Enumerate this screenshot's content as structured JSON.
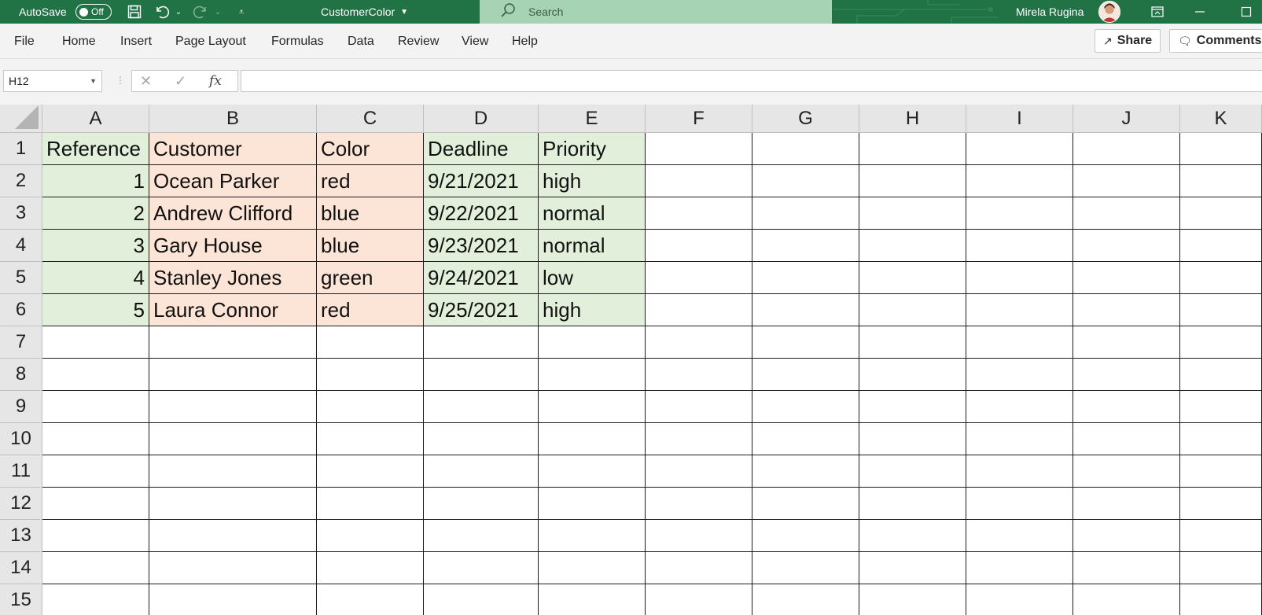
{
  "titlebar": {
    "autosave_label": "AutoSave",
    "autosave_state": "Off",
    "document_title": "CustomerColor",
    "search_placeholder": "Search",
    "user_name": "Mirela Rugina",
    "accent_color": "#217346"
  },
  "menu": {
    "items": [
      "File",
      "Home",
      "Insert",
      "Page Layout",
      "Formulas",
      "Data",
      "Review",
      "View",
      "Help"
    ],
    "share_label": "Share",
    "comments_label": "Comments"
  },
  "formula_bar": {
    "name_box": "H12",
    "cancel_glyph": "✕",
    "enter_glyph": "✓",
    "fx_label": "fx",
    "formula_value": ""
  },
  "sheet": {
    "columns": [
      "A",
      "B",
      "C",
      "D",
      "E",
      "F",
      "G",
      "H",
      "I",
      "J",
      "K"
    ],
    "rows": [
      "1",
      "2",
      "3",
      "4",
      "5",
      "6",
      "7",
      "8",
      "9",
      "10",
      "11",
      "12",
      "13",
      "14",
      "15"
    ],
    "header_row": [
      "Reference",
      "Customer",
      "Color",
      "Deadline",
      "Priority"
    ],
    "data_rows": [
      [
        "1",
        "Ocean Parker",
        "red",
        "9/21/2021",
        "high"
      ],
      [
        "2",
        "Andrew Clifford",
        "blue",
        "9/22/2021",
        "normal"
      ],
      [
        "3",
        "Gary House",
        "blue",
        "9/23/2021",
        "normal"
      ],
      [
        "4",
        "Stanley Jones",
        "green",
        "9/24/2021",
        "low"
      ],
      [
        "5",
        "Laura Connor",
        "red",
        "9/25/2021",
        "high"
      ]
    ],
    "fill_colors": {
      "green": "#e2efda",
      "pink": "#fce4d6"
    }
  }
}
